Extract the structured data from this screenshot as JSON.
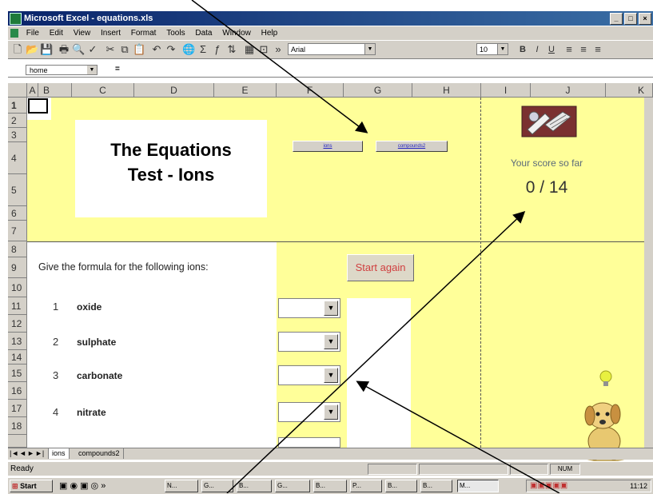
{
  "window": {
    "title": "Microsoft Excel - equations.xls",
    "min": "_",
    "restore": "□",
    "close": "×"
  },
  "menu": [
    "File",
    "Edit",
    "View",
    "Insert",
    "Format",
    "Tools",
    "Data",
    "Window",
    "Help"
  ],
  "toolbar": {
    "font_name": "Arial",
    "font_size": "10",
    "bold": "B",
    "italic": "I",
    "underline": "U"
  },
  "formula_bar": {
    "name_box": "home",
    "fx": "="
  },
  "columns": [
    "A",
    "B",
    "C",
    "D",
    "E",
    "F",
    "G",
    "H",
    "I",
    "J",
    "K"
  ],
  "rows": [
    "1",
    "2",
    "3",
    "4",
    "5",
    "6",
    "7",
    "8",
    "9",
    "10",
    "11",
    "12",
    "13",
    "14",
    "15",
    "16",
    "17",
    "18"
  ],
  "sheet": {
    "title_line1": "The Equations",
    "title_line2": "Test - Ions",
    "link_ions": "ions",
    "link_compounds": "compounds2",
    "score_label": "Your score so far",
    "score_value": "0 / 14",
    "instruction": "Give the formula for the following ions:",
    "start_again": "Start again",
    "questions": [
      {
        "num": "1",
        "ion": "oxide"
      },
      {
        "num": "2",
        "ion": "sulphate"
      },
      {
        "num": "3",
        "ion": "carbonate"
      },
      {
        "num": "4",
        "ion": "nitrate"
      }
    ]
  },
  "sheet_tabs": [
    "ions",
    "compounds2"
  ],
  "status": {
    "left": "Ready",
    "num": "NUM"
  },
  "taskbar": {
    "start": "Start",
    "clock": "11:12",
    "buttons": [
      "N...",
      "G...",
      "B...",
      "G...",
      "B...",
      "P...",
      "B...",
      "B...",
      "M..."
    ]
  }
}
